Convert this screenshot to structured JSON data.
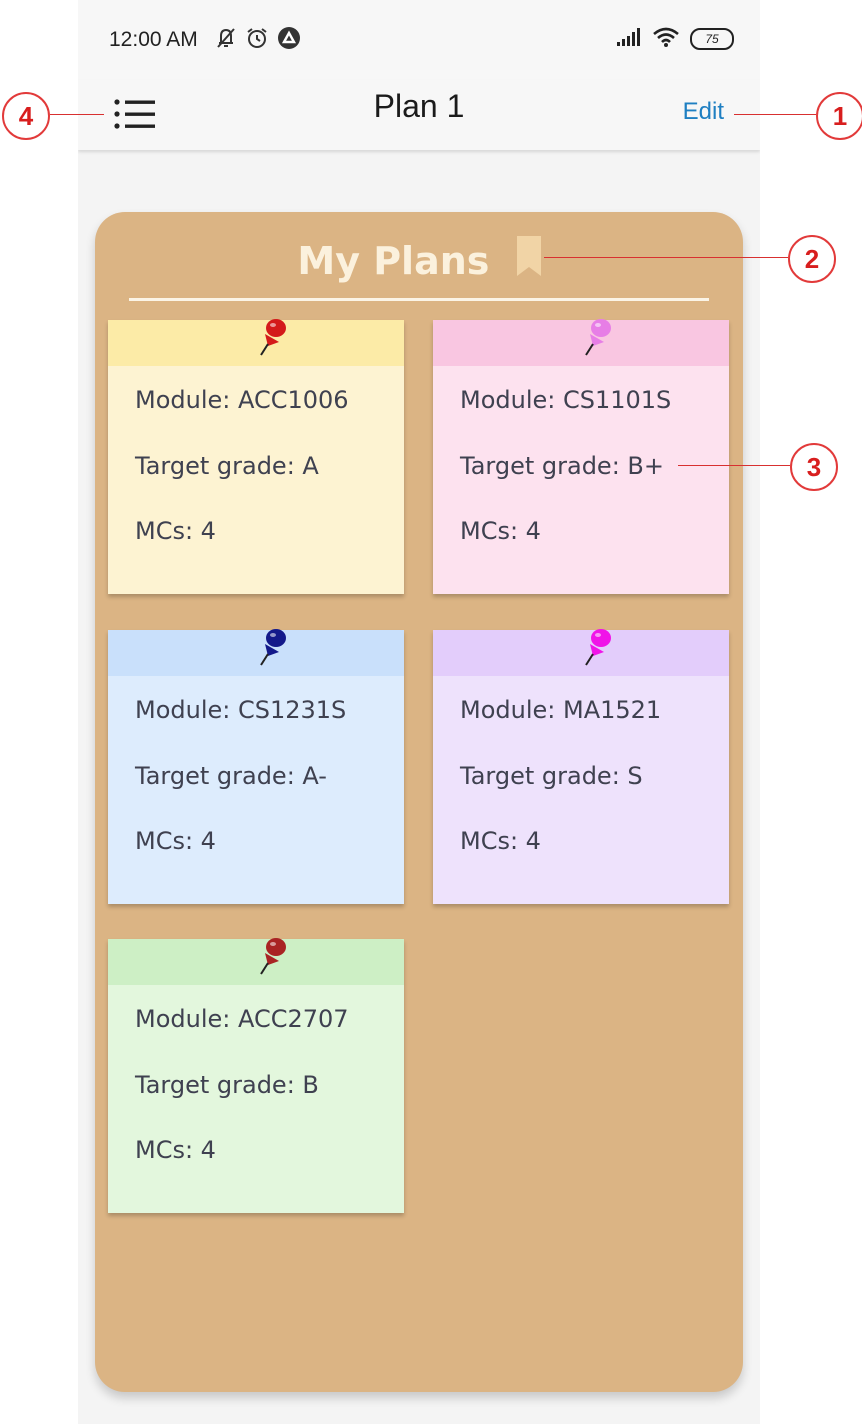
{
  "status_bar": {
    "time": "12:00 AM",
    "battery": "75",
    "icons": [
      "notifications-off-icon",
      "alarm-icon",
      "app-icon",
      "signal-icon",
      "wifi-icon",
      "battery-icon"
    ]
  },
  "header": {
    "title": "Plan 1",
    "edit_label": "Edit",
    "menu_icon": "list-menu-icon"
  },
  "board": {
    "title": "My Plans",
    "title_icon": "bookmark-icon",
    "notes": [
      {
        "module": "Module: ACC1006",
        "grade": "Target grade: A",
        "mcs": "MCs: 4",
        "head_color": "#fceba7",
        "body_color": "#fdf3d2",
        "pin_color": "#d41a1a"
      },
      {
        "module": "Module: CS1101S",
        "grade": "Target grade: B+",
        "mcs": "MCs: 4",
        "head_color": "#f9c6e1",
        "body_color": "#fde2ef",
        "pin_color": "#e77ee6"
      },
      {
        "module": "Module: CS1231S",
        "grade": "Target grade: A-",
        "mcs": "MCs: 4",
        "head_color": "#c9e0fb",
        "body_color": "#ddecfd",
        "pin_color": "#13198a"
      },
      {
        "module": "Module: MA1521",
        "grade": "Target grade: S",
        "mcs": "MCs: 4",
        "head_color": "#e3cdfb",
        "body_color": "#eee2fc",
        "pin_color": "#f014e8"
      },
      {
        "module": "Module: ACC2707",
        "grade": "Target grade: B",
        "mcs": "MCs: 4",
        "head_color": "#cdefc5",
        "body_color": "#e3f7dd",
        "pin_color": "#a92323"
      }
    ]
  },
  "callouts": [
    "1",
    "2",
    "3",
    "4"
  ]
}
